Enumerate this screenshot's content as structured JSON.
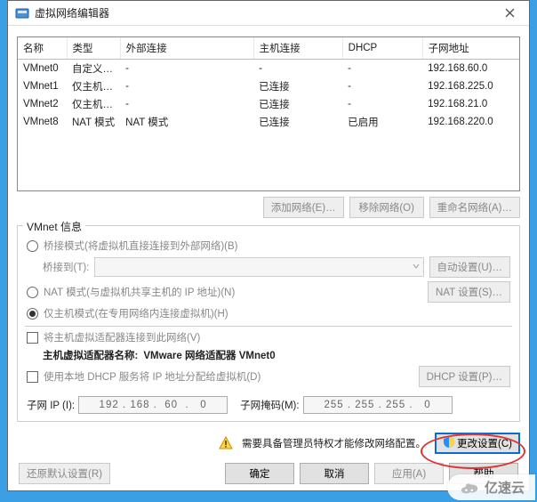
{
  "title": "虚拟网络编辑器",
  "table": {
    "headers": [
      "名称",
      "类型",
      "外部连接",
      "主机连接",
      "DHCP",
      "子网地址"
    ],
    "rows": [
      {
        "name": "VMnet0",
        "type": "自定义…",
        "ext": "-",
        "host": "-",
        "dhcp": "-",
        "subnet": "192.168.60.0"
      },
      {
        "name": "VMnet1",
        "type": "仅主机…",
        "ext": "-",
        "host": "已连接",
        "dhcp": "-",
        "subnet": "192.168.225.0"
      },
      {
        "name": "VMnet2",
        "type": "仅主机…",
        "ext": "-",
        "host": "已连接",
        "dhcp": "-",
        "subnet": "192.168.21.0"
      },
      {
        "name": "VMnet8",
        "type": "NAT 模式",
        "ext": "NAT 模式",
        "host": "已连接",
        "dhcp": "已启用",
        "subnet": "192.168.220.0"
      }
    ]
  },
  "top_buttons": {
    "add": "添加网络(E)…",
    "remove": "移除网络(O)",
    "rename": "重命名网络(A)…"
  },
  "group": {
    "legend": "VMnet 信息",
    "bridged_label": "桥接模式(将虚拟机直接连接到外部网络)(B)",
    "bridged_to_label": "桥接到(T):",
    "bridged_select_value": "",
    "auto_set_btn": "自动设置(U)…",
    "nat_label": "NAT 模式(与虚拟机共享主机的 IP 地址)(N)",
    "nat_set_btn": "NAT 设置(S)…",
    "hostonly_label": "仅主机模式(在专用网络内连接虚拟机)(H)",
    "connect_adapter_label": "将主机虚拟适配器连接到此网络(V)",
    "adapter_name_prefix": "主机虚拟适配器名称: ",
    "adapter_name_value": "VMware 网络适配器 VMnet0",
    "dhcp_assign_label": "使用本地 DHCP 服务将 IP 地址分配给虚拟机(D)",
    "dhcp_set_btn": "DHCP 设置(P)…"
  },
  "ip": {
    "subnet_ip_label": "子网 IP (I):",
    "subnet_ip_value": "192 . 168 .  60  .   0",
    "subnet_mask_label": "子网掩码(M):",
    "subnet_mask_value": "255 . 255 . 255 .   0"
  },
  "admin": {
    "notice": "需要具备管理员特权才能修改网络配置。",
    "change_button": "更改设置(C)"
  },
  "bottom": {
    "restore": "还原默认设置(R)",
    "ok": "确定",
    "cancel": "取消",
    "apply": "应用(A)",
    "help": "帮助"
  },
  "watermark": "亿速云"
}
